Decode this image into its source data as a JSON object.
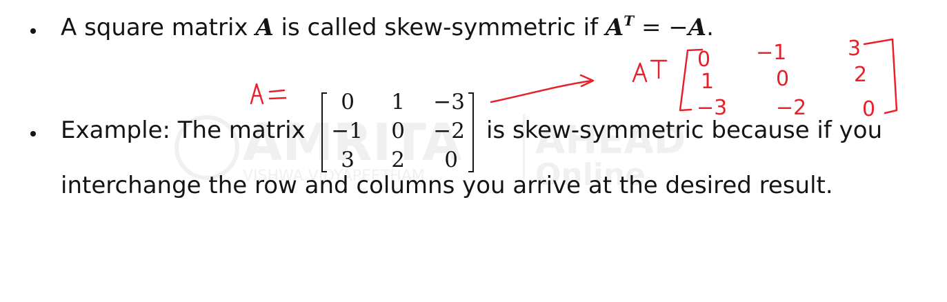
{
  "bullet1": {
    "prefix": "A square matrix ",
    "matrix_symbol": "A",
    "middle": " is called skew-symmetric if ",
    "lhs_symbol": "A",
    "superscript": "T",
    "equals": " = −",
    "rhs_symbol": "A",
    "suffix": "."
  },
  "bullet2": {
    "prefix": "Example: The matrix",
    "after_matrix": "is skew-symmetric because if you",
    "line2": "interchange the row and columns you arrive at the desired result."
  },
  "matrix": {
    "rows": [
      [
        "0",
        "1",
        "−3"
      ],
      [
        "−1",
        "0",
        "−2"
      ],
      [
        "3",
        "2",
        "0"
      ]
    ]
  },
  "annotations": {
    "a_label": "A =",
    "at_label": "A T",
    "transpose_rows": [
      [
        "0",
        "−1",
        "3"
      ],
      [
        "1",
        "0",
        "2"
      ],
      [
        "−3",
        "−2",
        "0"
      ]
    ]
  },
  "watermark": {
    "logo_text": "AMRITA",
    "ahead_text": "AHEAD",
    "online_text": "Online",
    "sub_text": "VISHWA VIDYAPEETHAM"
  },
  "colors": {
    "text": "#141414",
    "annotation": "#e8202a",
    "watermark": "#bdbdbd"
  }
}
